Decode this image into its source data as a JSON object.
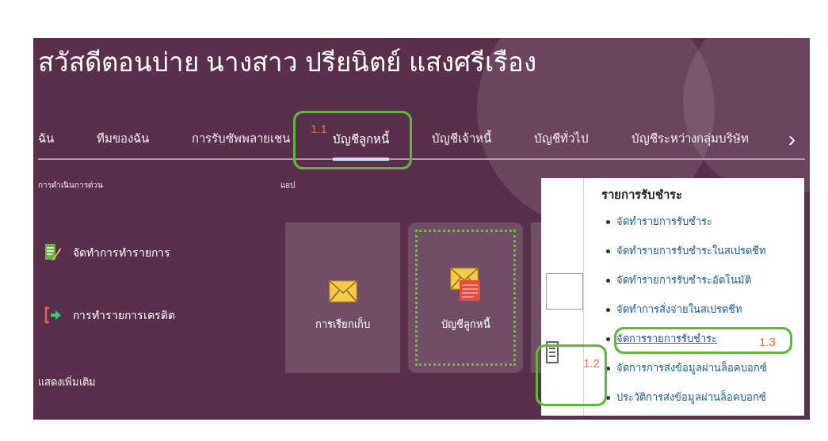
{
  "greeting": "สวัสดีตอนบ่าย นางสาว ปรียนิตย์ แสงศรีเรือง",
  "tabs": [
    {
      "label": "ฉัน",
      "selected": false
    },
    {
      "label": "ทีมของฉัน",
      "selected": false
    },
    {
      "label": "การรับซัพพลายเชน",
      "selected": false
    },
    {
      "label": "บัญชีลูกหนี้",
      "selected": true
    },
    {
      "label": "บัญชีเจ้าหนี้",
      "selected": false
    },
    {
      "label": "บัญชีทั่วไป",
      "selected": false
    },
    {
      "label": "บัญชีระหว่างกลุ่มบริษัท",
      "selected": false
    }
  ],
  "next_arrow": "›",
  "quick_actions": {
    "heading": "การดำเนินการด่วน",
    "items": [
      {
        "label": "จัดทำการทำรายการ",
        "kind": "edit"
      },
      {
        "label": "การทำรายการเครดิต",
        "kind": "exit"
      }
    ],
    "show_more": "แสดงเพิ่มเติม"
  },
  "apps": {
    "heading": "แอป",
    "tiles": [
      {
        "label": "การเรียกเก็บ",
        "kind": "mail",
        "highlighted": false
      },
      {
        "label": "บัญชีลูกหนี้",
        "kind": "mail-doc",
        "highlighted": true
      }
    ]
  },
  "menu": {
    "heading": "รายการรับชำระ",
    "items": [
      {
        "label": "จัดทำรายการรับชำระ",
        "underlined": false
      },
      {
        "label": "จัดทำรายการรับชำระในสเปรดชีท",
        "underlined": false
      },
      {
        "label": "จัดทำรายการรับชำระอัตโนมัติ",
        "underlined": false
      },
      {
        "label": "จัดทำการสั่งจ่ายในสเปรดชีท",
        "underlined": false
      },
      {
        "label": "จัดการรายการรับชำระ",
        "underlined": true
      },
      {
        "label": "จัดการการส่งข้อมูลผ่านล็อคบอกซ์",
        "underlined": false
      },
      {
        "label": "ประวัติการส่งข้อมูลผ่านล็อคบอกซ์",
        "underlined": false
      }
    ]
  },
  "annotations": [
    "1.1",
    "1.2",
    "1.3"
  ]
}
